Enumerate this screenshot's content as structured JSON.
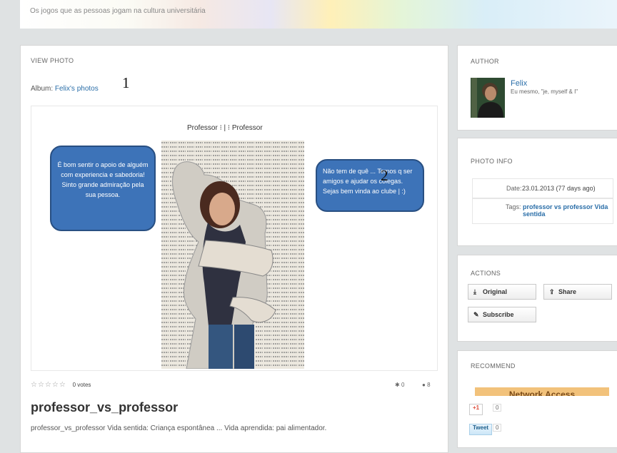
{
  "header": {
    "tagline": "Os jogos que as pessoas jogam na cultura universitária"
  },
  "main": {
    "section_title": "VIEW PHOTO",
    "album_label": "Album:",
    "album_link": "Felix's photos",
    "marker_1": "1",
    "marker_2": "2",
    "photo": {
      "caption": "Professor ⁝ | ⁝ Professor",
      "bubble_left": "É bom sentir o apoio de alguém com experiencia e sabedoria! Sinto grande admiração pela sua pessoa.",
      "bubble_right": "Não tem de quê ... Temos q ser amigos e ajudar os colegas. Sejas bem vinda ao clube | :)"
    },
    "rating_stars": "☆☆☆☆☆",
    "votes": "0 votes",
    "likes_icon": "✱",
    "likes": "0",
    "views_icon": "●",
    "views": "8",
    "title": "professor_vs_professor",
    "description": "professor_vs_professor Vida sentida: Criança espontânea ... Vida aprendida: pai alimentador."
  },
  "author": {
    "section_title": "AUTHOR",
    "name": "Felix",
    "bio": "Eu mesmo, \"je, myself & I\""
  },
  "photo_info": {
    "section_title": "PHOTO INFO",
    "date_label": "Date:",
    "date_value": "23.01.2013 (77 days ago)",
    "tags_label": "Tags:",
    "tags_value": "professor vs professor Vida sentida",
    "tags_color": "#2a6ea8"
  },
  "actions": {
    "section_title": "ACTIONS",
    "original": "Original",
    "share": "Share",
    "subscribe": "Subscribe"
  },
  "recommend": {
    "section_title": "RECOMMEND",
    "ad_text": "Network Access",
    "gplus": "+1",
    "gplus_count": "0",
    "tweet": "Tweet",
    "tweet_count": "0"
  },
  "colors": {
    "link": "#2a6ea8",
    "bubble": "#3d73b8"
  }
}
